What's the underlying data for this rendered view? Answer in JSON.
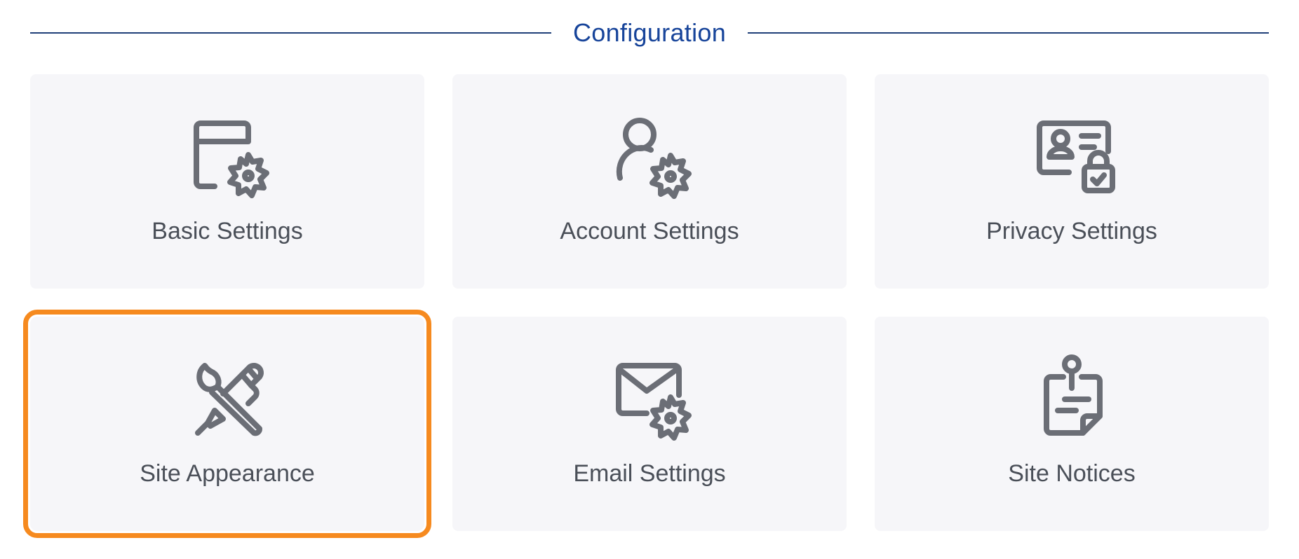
{
  "section": {
    "title": "Configuration"
  },
  "cards": [
    {
      "label": "Basic Settings",
      "icon": "browser-gear-icon",
      "selected": false
    },
    {
      "label": "Account Settings",
      "icon": "user-gear-icon",
      "selected": false
    },
    {
      "label": "Privacy Settings",
      "icon": "id-card-lock-icon",
      "selected": false
    },
    {
      "label": "Site Appearance",
      "icon": "brush-pen-icon",
      "selected": true
    },
    {
      "label": "Email Settings",
      "icon": "envelope-gear-icon",
      "selected": false
    },
    {
      "label": "Site Notices",
      "icon": "pinned-note-icon",
      "selected": false
    }
  ],
  "colors": {
    "heading": "#17449a",
    "divider": "#1f3f78",
    "card_bg": "#f6f6f9",
    "icon": "#6b6e76",
    "label": "#4a4f58",
    "selection": "#f68a1f"
  }
}
